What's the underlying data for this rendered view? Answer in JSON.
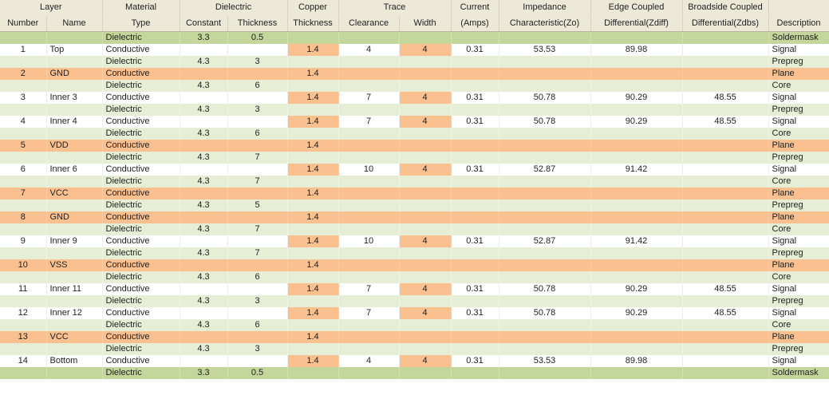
{
  "header": {
    "groups": [
      {
        "label": "Layer",
        "span": 2
      },
      {
        "label": "Material",
        "span": 1
      },
      {
        "label": "Dielectric",
        "span": 2
      },
      {
        "label": "Copper",
        "span": 1
      },
      {
        "label": "Trace",
        "span": 2
      },
      {
        "label": "Current",
        "span": 1
      },
      {
        "label": "Impedance",
        "span": 1
      },
      {
        "label": "Edge Coupled",
        "span": 1
      },
      {
        "label": "Broadside Coupled",
        "span": 1
      },
      {
        "label": "",
        "span": 1
      }
    ],
    "columns": [
      "Number",
      "Name",
      "Type",
      "Constant",
      "Thickness",
      "Thickness",
      "Clearance",
      "Width",
      "(Amps)",
      "Characteristic(Zo)",
      "Differential(Zdiff)",
      "Differential(Zdbs)",
      "Description"
    ]
  },
  "colors": {
    "soldermask": "#c3d69b",
    "dielectric": "#e6eed5",
    "signal": "#ffffff",
    "plane": "#fac090",
    "highlight": "#fac090",
    "header": "#ece9d8"
  },
  "rows": [
    {
      "style": "soldermask",
      "number": "",
      "name": "",
      "type": "Dielectric",
      "constant": "3.3",
      "dthick": "0.5",
      "cthick": "",
      "clearance": "",
      "width": "",
      "current": "",
      "zo": "",
      "zdiff": "",
      "zdbs": "",
      "description": "Soldermask",
      "hl": []
    },
    {
      "style": "signal",
      "number": "1",
      "name": "Top",
      "type": "Conductive",
      "constant": "",
      "dthick": "",
      "cthick": "1.4",
      "clearance": "4",
      "width": "4",
      "current": "0.31",
      "zo": "53.53",
      "zdiff": "89.98",
      "zdbs": "",
      "description": "Signal",
      "hl": [
        "cthick",
        "width"
      ]
    },
    {
      "style": "dielectric",
      "number": "",
      "name": "",
      "type": "Dielectric",
      "constant": "4.3",
      "dthick": "3",
      "cthick": "",
      "clearance": "",
      "width": "",
      "current": "",
      "zo": "",
      "zdiff": "",
      "zdbs": "",
      "description": "Prepreg",
      "hl": []
    },
    {
      "style": "plane",
      "number": "2",
      "name": "GND",
      "type": "Conductive",
      "constant": "",
      "dthick": "",
      "cthick": "1.4",
      "clearance": "",
      "width": "",
      "current": "",
      "zo": "",
      "zdiff": "",
      "zdbs": "",
      "description": "Plane",
      "hl": []
    },
    {
      "style": "dielectric",
      "number": "",
      "name": "",
      "type": "Dielectric",
      "constant": "4.3",
      "dthick": "6",
      "cthick": "",
      "clearance": "",
      "width": "",
      "current": "",
      "zo": "",
      "zdiff": "",
      "zdbs": "",
      "description": "Core",
      "hl": []
    },
    {
      "style": "signal",
      "number": "3",
      "name": "Inner 3",
      "type": "Conductive",
      "constant": "",
      "dthick": "",
      "cthick": "1.4",
      "clearance": "7",
      "width": "4",
      "current": "0.31",
      "zo": "50.78",
      "zdiff": "90.29",
      "zdbs": "48.55",
      "description": "Signal",
      "hl": [
        "cthick",
        "width"
      ]
    },
    {
      "style": "dielectric",
      "number": "",
      "name": "",
      "type": "Dielectric",
      "constant": "4.3",
      "dthick": "3",
      "cthick": "",
      "clearance": "",
      "width": "",
      "current": "",
      "zo": "",
      "zdiff": "",
      "zdbs": "",
      "description": "Prepreg",
      "hl": []
    },
    {
      "style": "signal",
      "number": "4",
      "name": "Inner 4",
      "type": "Conductive",
      "constant": "",
      "dthick": "",
      "cthick": "1.4",
      "clearance": "7",
      "width": "4",
      "current": "0.31",
      "zo": "50.78",
      "zdiff": "90.29",
      "zdbs": "48.55",
      "description": "Signal",
      "hl": [
        "cthick",
        "width"
      ]
    },
    {
      "style": "dielectric",
      "number": "",
      "name": "",
      "type": "Dielectric",
      "constant": "4.3",
      "dthick": "6",
      "cthick": "",
      "clearance": "",
      "width": "",
      "current": "",
      "zo": "",
      "zdiff": "",
      "zdbs": "",
      "description": "Core",
      "hl": []
    },
    {
      "style": "plane",
      "number": "5",
      "name": "VDD",
      "type": "Conductive",
      "constant": "",
      "dthick": "",
      "cthick": "1.4",
      "clearance": "",
      "width": "",
      "current": "",
      "zo": "",
      "zdiff": "",
      "zdbs": "",
      "description": "Plane",
      "hl": []
    },
    {
      "style": "dielectric",
      "number": "",
      "name": "",
      "type": "Dielectric",
      "constant": "4.3",
      "dthick": "7",
      "cthick": "",
      "clearance": "",
      "width": "",
      "current": "",
      "zo": "",
      "zdiff": "",
      "zdbs": "",
      "description": "Prepreg",
      "hl": []
    },
    {
      "style": "signal",
      "number": "6",
      "name": "Inner 6",
      "type": "Conductive",
      "constant": "",
      "dthick": "",
      "cthick": "1.4",
      "clearance": "10",
      "width": "4",
      "current": "0.31",
      "zo": "52.87",
      "zdiff": "91.42",
      "zdbs": "",
      "description": "Signal",
      "hl": [
        "cthick",
        "width"
      ]
    },
    {
      "style": "dielectric",
      "number": "",
      "name": "",
      "type": "Dielectric",
      "constant": "4.3",
      "dthick": "7",
      "cthick": "",
      "clearance": "",
      "width": "",
      "current": "",
      "zo": "",
      "zdiff": "",
      "zdbs": "",
      "description": "Core",
      "hl": []
    },
    {
      "style": "plane",
      "number": "7",
      "name": "VCC",
      "type": "Conductive",
      "constant": "",
      "dthick": "",
      "cthick": "1.4",
      "clearance": "",
      "width": "",
      "current": "",
      "zo": "",
      "zdiff": "",
      "zdbs": "",
      "description": "Plane",
      "hl": []
    },
    {
      "style": "dielectric",
      "number": "",
      "name": "",
      "type": "Dielectric",
      "constant": "4.3",
      "dthick": "5",
      "cthick": "",
      "clearance": "",
      "width": "",
      "current": "",
      "zo": "",
      "zdiff": "",
      "zdbs": "",
      "description": "Prepreg",
      "hl": []
    },
    {
      "style": "plane",
      "number": "8",
      "name": "GND",
      "type": "Conductive",
      "constant": "",
      "dthick": "",
      "cthick": "1.4",
      "clearance": "",
      "width": "",
      "current": "",
      "zo": "",
      "zdiff": "",
      "zdbs": "",
      "description": "Plane",
      "hl": []
    },
    {
      "style": "dielectric",
      "number": "",
      "name": "",
      "type": "Dielectric",
      "constant": "4.3",
      "dthick": "7",
      "cthick": "",
      "clearance": "",
      "width": "",
      "current": "",
      "zo": "",
      "zdiff": "",
      "zdbs": "",
      "description": "Core",
      "hl": []
    },
    {
      "style": "signal",
      "number": "9",
      "name": "Inner 9",
      "type": "Conductive",
      "constant": "",
      "dthick": "",
      "cthick": "1.4",
      "clearance": "10",
      "width": "4",
      "current": "0.31",
      "zo": "52.87",
      "zdiff": "91.42",
      "zdbs": "",
      "description": "Signal",
      "hl": [
        "cthick",
        "width"
      ]
    },
    {
      "style": "dielectric",
      "number": "",
      "name": "",
      "type": "Dielectric",
      "constant": "4.3",
      "dthick": "7",
      "cthick": "",
      "clearance": "",
      "width": "",
      "current": "",
      "zo": "",
      "zdiff": "",
      "zdbs": "",
      "description": "Prepreg",
      "hl": []
    },
    {
      "style": "plane",
      "number": "10",
      "name": "VSS",
      "type": "Conductive",
      "constant": "",
      "dthick": "",
      "cthick": "1.4",
      "clearance": "",
      "width": "",
      "current": "",
      "zo": "",
      "zdiff": "",
      "zdbs": "",
      "description": "Plane",
      "hl": []
    },
    {
      "style": "dielectric",
      "number": "",
      "name": "",
      "type": "Dielectric",
      "constant": "4.3",
      "dthick": "6",
      "cthick": "",
      "clearance": "",
      "width": "",
      "current": "",
      "zo": "",
      "zdiff": "",
      "zdbs": "",
      "description": "Core",
      "hl": []
    },
    {
      "style": "signal",
      "number": "11",
      "name": "Inner 11",
      "type": "Conductive",
      "constant": "",
      "dthick": "",
      "cthick": "1.4",
      "clearance": "7",
      "width": "4",
      "current": "0.31",
      "zo": "50.78",
      "zdiff": "90.29",
      "zdbs": "48.55",
      "description": "Signal",
      "hl": [
        "cthick",
        "width"
      ]
    },
    {
      "style": "dielectric",
      "number": "",
      "name": "",
      "type": "Dielectric",
      "constant": "4.3",
      "dthick": "3",
      "cthick": "",
      "clearance": "",
      "width": "",
      "current": "",
      "zo": "",
      "zdiff": "",
      "zdbs": "",
      "description": "Prepreg",
      "hl": []
    },
    {
      "style": "signal",
      "number": "12",
      "name": "Inner 12",
      "type": "Conductive",
      "constant": "",
      "dthick": "",
      "cthick": "1.4",
      "clearance": "7",
      "width": "4",
      "current": "0.31",
      "zo": "50.78",
      "zdiff": "90.29",
      "zdbs": "48.55",
      "description": "Signal",
      "hl": [
        "cthick",
        "width"
      ]
    },
    {
      "style": "dielectric",
      "number": "",
      "name": "",
      "type": "Dielectric",
      "constant": "4.3",
      "dthick": "6",
      "cthick": "",
      "clearance": "",
      "width": "",
      "current": "",
      "zo": "",
      "zdiff": "",
      "zdbs": "",
      "description": "Core",
      "hl": []
    },
    {
      "style": "plane",
      "number": "13",
      "name": "VCC",
      "type": "Conductive",
      "constant": "",
      "dthick": "",
      "cthick": "1.4",
      "clearance": "",
      "width": "",
      "current": "",
      "zo": "",
      "zdiff": "",
      "zdbs": "",
      "description": "Plane",
      "hl": []
    },
    {
      "style": "dielectric",
      "number": "",
      "name": "",
      "type": "Dielectric",
      "constant": "4.3",
      "dthick": "3",
      "cthick": "",
      "clearance": "",
      "width": "",
      "current": "",
      "zo": "",
      "zdiff": "",
      "zdbs": "",
      "description": "Prepreg",
      "hl": []
    },
    {
      "style": "signal",
      "number": "14",
      "name": "Bottom",
      "type": "Conductive",
      "constant": "",
      "dthick": "",
      "cthick": "1.4",
      "clearance": "4",
      "width": "4",
      "current": "0.31",
      "zo": "53.53",
      "zdiff": "89.98",
      "zdbs": "",
      "description": "Signal",
      "hl": [
        "cthick",
        "width"
      ]
    },
    {
      "style": "soldermask",
      "number": "",
      "name": "",
      "type": "Dielectric",
      "constant": "3.3",
      "dthick": "0.5",
      "cthick": "",
      "clearance": "",
      "width": "",
      "current": "",
      "zo": "",
      "zdiff": "",
      "zdbs": "",
      "description": "Soldermask",
      "hl": []
    }
  ]
}
